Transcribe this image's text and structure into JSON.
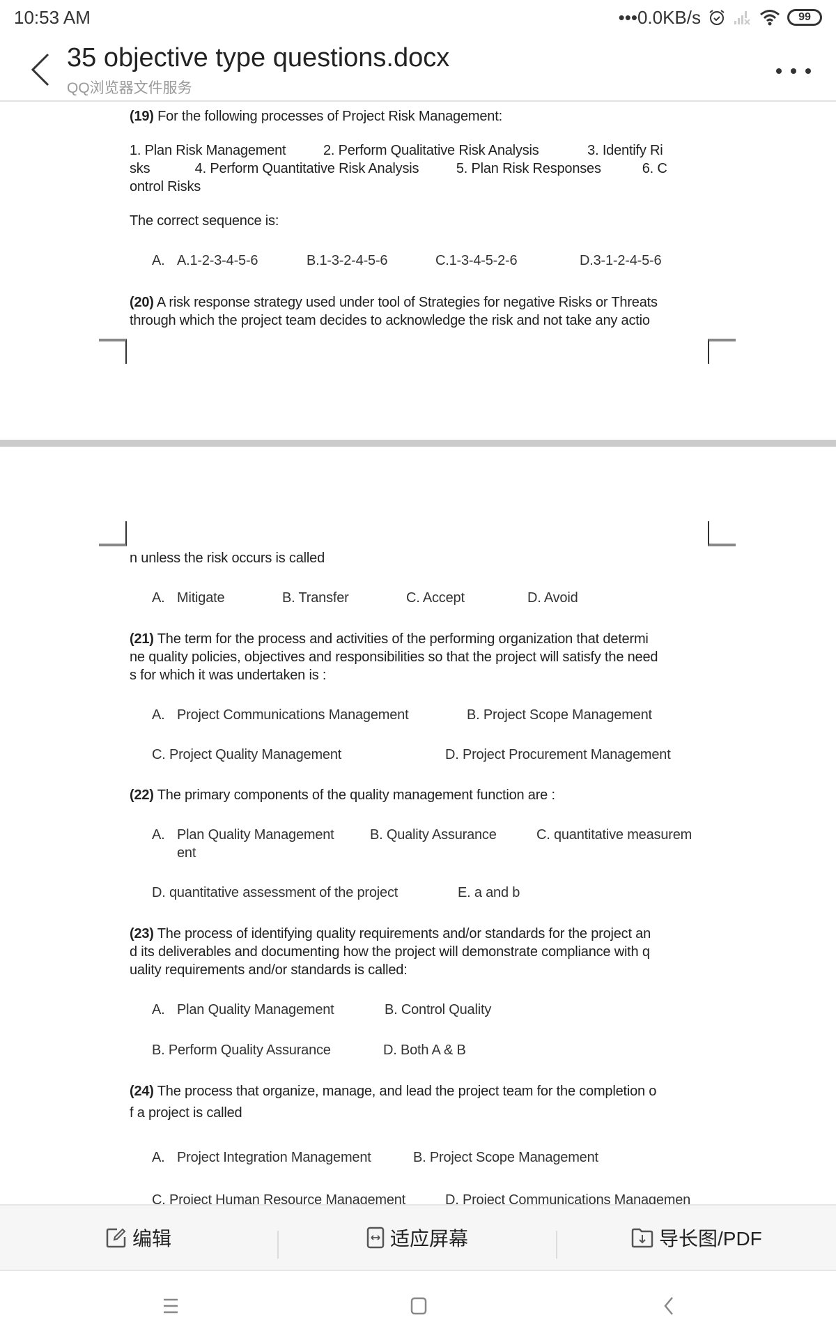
{
  "status_bar": {
    "time": "10:53  AM",
    "net_speed": "•••0.0KB/s",
    "battery": "99",
    "icons": [
      "alarm-icon",
      "signal-icon",
      "wifi-icon",
      "battery-icon"
    ]
  },
  "header": {
    "title": "35 objective type questions.docx",
    "subtitle": "QQ浏览器文件服务",
    "back_icon": "chevron-left-icon",
    "more_icon": "more-dots-icon"
  },
  "document": {
    "q19": {
      "number": "(19)",
      "text": " For the following processes of Project Risk Management:",
      "processes_line1": "1. Plan Risk Management          2. Perform Qualitative Risk Analysis             3. Identify Ri",
      "processes_line2": "sks            4. Perform Quantitative Risk Analysis          5. Plan Risk Responses           6. C",
      "processes_line3": "ontrol Risks",
      "prompt": "The correct sequence is:",
      "options": [
        "A.",
        "A.1-2-3-4-5-6",
        "B.1-3-2-4-5-6",
        "C.1-3-4-5-2-6",
        "D.3-1-2-4-5-6"
      ]
    },
    "q20": {
      "number": "(20)",
      "line1": " A risk response strategy used under tool of Strategies for negative Risks or Threats",
      "line2": "through which the project team decides to acknowledge the risk and not take any actio",
      "line3": "n unless the risk occurs is called",
      "options": [
        "A.",
        "Mitigate",
        "B. Transfer",
        "C. Accept",
        "D. Avoid"
      ]
    },
    "q21": {
      "number": "(21)",
      "line1": " The term for the process and activities of the performing organization that determi",
      "line2": "ne quality policies, objectives and responsibilities so that the project will satisfy the need",
      "line3": "s for which it was undertaken is :",
      "options": [
        "A.",
        "Project Communications Management",
        "B. Project Scope Management",
        "C. Project Quality Management",
        "D. Project Procurement Management"
      ]
    },
    "q22": {
      "number": "(22)",
      "text": " The primary components of the quality management function are :",
      "options": [
        "A.",
        "Plan Quality Management",
        "B. Quality Assurance",
        "C. quantitative measurem",
        "ent",
        "D. quantitative assessment of the project",
        "E. a and b"
      ]
    },
    "q23": {
      "number": "(23)",
      "line1": " The process of identifying quality requirements and/or standards for the project an",
      "line2": "d its deliverables and documenting how the project will demonstrate compliance with q",
      "line3": "uality requirements and/or standards is called:",
      "options": [
        "A.",
        "Plan Quality Management",
        "B. Control Quality",
        "B. Perform Quality Assurance",
        "D. Both A & B"
      ]
    },
    "q24": {
      "number": "(24)",
      "line1": " The process that organize, manage, and lead the project team for the completion o",
      "line2": "f a project is called",
      "options": [
        "A.",
        "Project Integration Management",
        "B. Project Scope Management",
        "C. Project Human Resource Management",
        "D. Project Communications Managemen"
      ]
    }
  },
  "toolbar": {
    "edit_label": "编辑",
    "fit_label": "适应屏幕",
    "export_label": "导长图/PDF"
  },
  "navbar": {
    "items": [
      "menu-icon",
      "home-icon",
      "back-icon"
    ]
  }
}
